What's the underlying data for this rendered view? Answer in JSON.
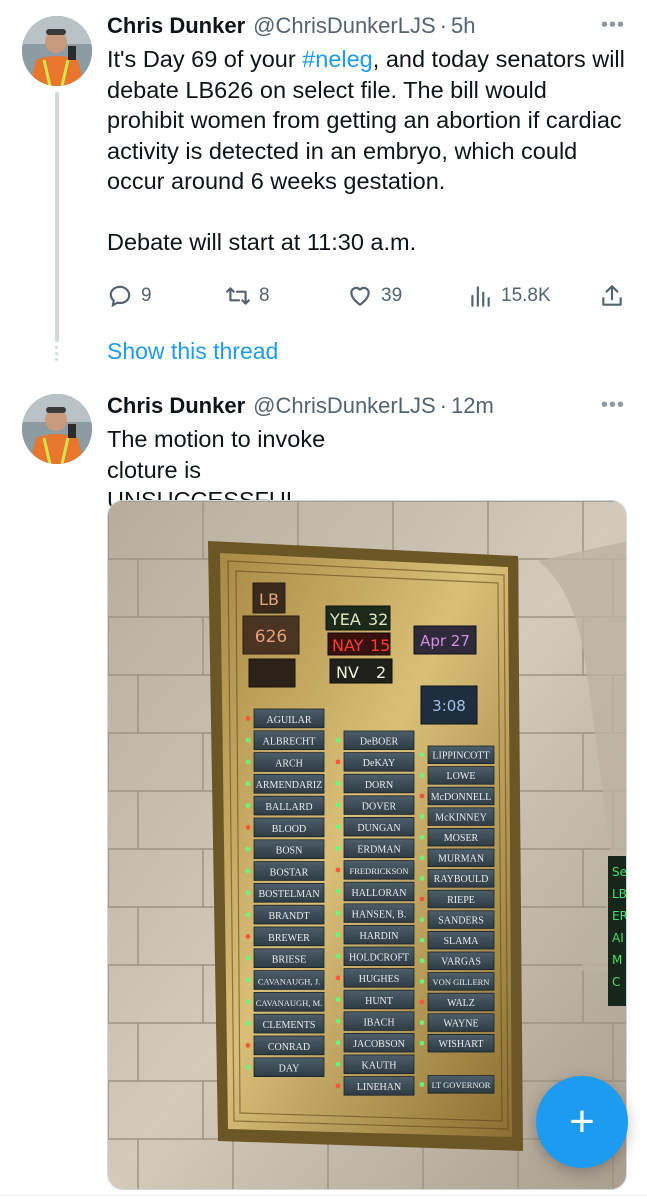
{
  "tweets": [
    {
      "name": "Chris Dunker",
      "handle": "@ChrisDunkerLJS",
      "separator": "·",
      "time": "5h",
      "more": "•••",
      "text_pre": "It's Day 69 of your ",
      "hashtag": "#neleg",
      "text_post": ", and today senators will debate LB626 on select file. The bill would prohibit women from getting an abortion if cardiac activity is detected in an embryo, which could occur around 6 weeks gestation.",
      "text_2": "Debate will start at 11:30 a.m.",
      "stats": {
        "replies": "9",
        "retweets": "8",
        "likes": "39",
        "views": "15.8K"
      },
      "show_thread": "Show this thread"
    },
    {
      "name": "Chris Dunker",
      "handle": "@ChrisDunkerLJS",
      "separator": "·",
      "time": "12m",
      "more": "•••",
      "text": "The motion to invoke cloture is UNSUCCESSFUL"
    }
  ],
  "board": {
    "bill_label": "LB",
    "bill_number": "626",
    "yea_label": "YEA",
    "yea": "32",
    "nay_label": "NAY",
    "nay": "15",
    "nv_label": "NV",
    "nv": "2",
    "date": "Apr 27",
    "clock": "3:08",
    "col1": [
      "AGUILAR",
      "ALBRECHT",
      "ARCH",
      "ARMENDARIZ",
      "BALLARD",
      "BLOOD",
      "BOSN",
      "BOSTAR",
      "BOSTELMAN",
      "BRANDT",
      "BREWER",
      "BRIESE",
      "CAVANAUGH, J.",
      "CAVANAUGH, M.",
      "CLEMENTS",
      "CONRAD",
      "DAY"
    ],
    "col2": [
      "DeBOER",
      "DeKAY",
      "DORN",
      "DOVER",
      "DUNGAN",
      "ERDMAN",
      "FREDRICKSON",
      "HALLORAN",
      "HANSEN, B.",
      "HARDIN",
      "HOLDCROFT",
      "HUGHES",
      "HUNT",
      "IBACH",
      "JACOBSON",
      "KAUTH",
      "LINEHAN"
    ],
    "col3": [
      "LIPPINCOTT",
      "LOWE",
      "McDONNELL",
      "McKINNEY",
      "MOSER",
      "MURMAN",
      "RAYBOULD",
      "RIEPE",
      "SANDERS",
      "SLAMA",
      "VARGAS",
      "VON GILLERN",
      "WALZ",
      "WAYNE",
      "WISHART",
      "",
      "LT GOVERNOR"
    ],
    "side_sign": [
      "Se",
      "LB",
      "ER",
      "AI",
      "M",
      "C"
    ]
  },
  "fab_label": "+"
}
